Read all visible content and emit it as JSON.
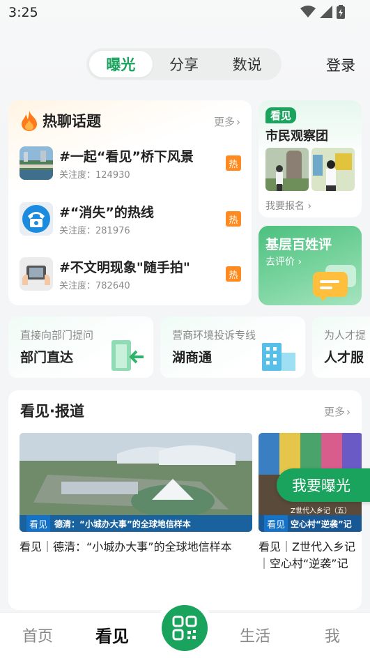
{
  "status_bar": {
    "time": "3:25"
  },
  "top_nav": {
    "tabs": [
      {
        "label": "曝光",
        "active": true
      },
      {
        "label": "分享",
        "active": false
      },
      {
        "label": "数说",
        "active": false
      }
    ],
    "login_label": "登录"
  },
  "hot_topics": {
    "title": "热聊话题",
    "more_label": "更多",
    "items": [
      {
        "name": "#一起“看见”桥下风景",
        "meta": "关注度：124930",
        "badge": "热"
      },
      {
        "name": "#“消失”的热线",
        "meta": "关注度：281976",
        "badge": "热"
      },
      {
        "name": "#不文明现象\"随手拍\"",
        "meta": "关注度：782640",
        "badge": "热"
      }
    ]
  },
  "observers": {
    "tag": "看见",
    "title": "市民观察团",
    "signup_label": "我要报名"
  },
  "review": {
    "title": "基层百姓评",
    "subtitle": "去评价"
  },
  "services": [
    {
      "subtitle": "直接向部门提问",
      "title": "部门直达"
    },
    {
      "subtitle": "营商环境投诉专线",
      "title": "湖商通"
    },
    {
      "subtitle": "为人才提",
      "title": "人才服"
    }
  ],
  "report": {
    "title": "看见·报道",
    "more_label": "更多",
    "items": [
      {
        "caption": "看见｜德清：“小城办大事”的全球地信样本",
        "overlay_logo": "看见",
        "overlay_text": "德清：“小城办大事”的全球地信样本"
      },
      {
        "caption": "看见｜Z世代入乡记｜空心村“逆袭”记",
        "overlay_logo": "看见",
        "overlay_text": "空心村“逆袭”记",
        "overlay_top": "Z世代入乡记（五）"
      }
    ]
  },
  "fab_label": "我要曝光",
  "bottom_nav": {
    "items": [
      {
        "label": "首页",
        "active": false
      },
      {
        "label": "看见",
        "active": true
      },
      {
        "label": "生活",
        "active": false
      },
      {
        "label": "我",
        "active": false
      }
    ]
  },
  "colors": {
    "brand_green": "#1aa35d",
    "hot_orange": "#ff8a1f"
  }
}
